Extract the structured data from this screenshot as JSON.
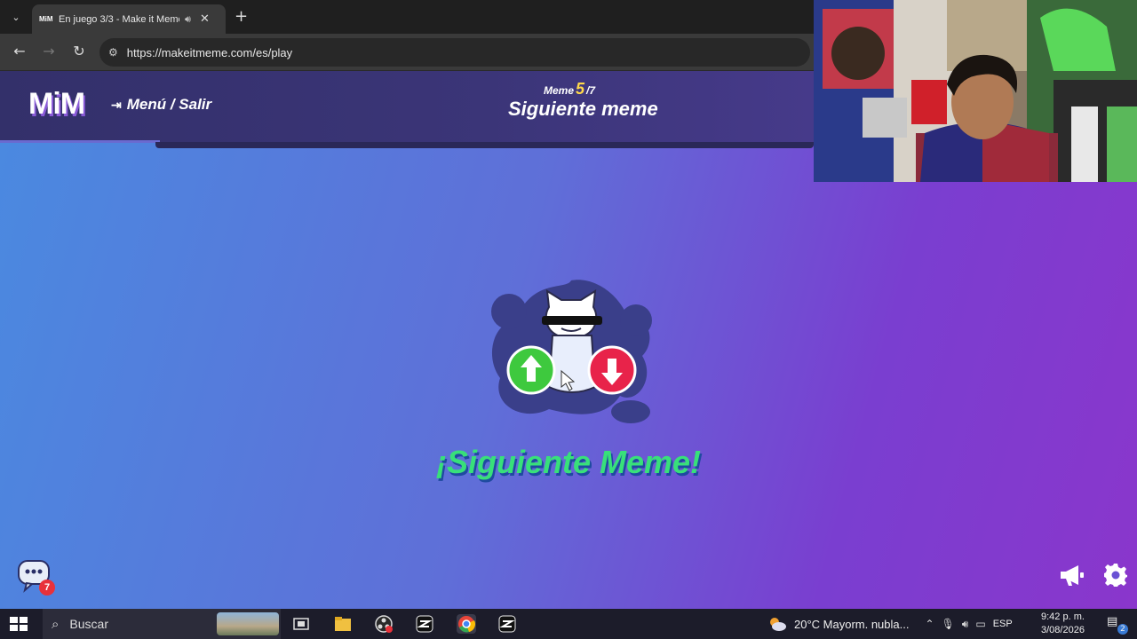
{
  "browser": {
    "tab_title": "En juego 3/3 - Make it Meme",
    "tab_favicon": "MiM",
    "url": "https://makeitmeme.com/es/play",
    "icons": [
      "tab-dropdown-icon",
      "speaker-icon",
      "close-icon",
      "plus-icon",
      "back-arrow-icon",
      "forward-arrow-icon",
      "reload-icon",
      "site-settings-icon"
    ]
  },
  "game": {
    "logo": "MiM",
    "menu_label": "Menú / Salir",
    "counter_prefix": "Meme",
    "counter_current": "5",
    "counter_total": "/7",
    "header_title": "Siguiente meme",
    "banner": "¡Siguiente Meme!",
    "chat_badge": "7",
    "colors": {
      "banner": "#38e07a",
      "counter_highlight": "#ffd84a",
      "upvote": "#3ec93e",
      "downvote": "#e8234a"
    },
    "icons": [
      "exit-icon",
      "cat-mascot-icon",
      "upvote-arrow-icon",
      "downvote-arrow-icon",
      "chat-bubble-icon",
      "megaphone-icon",
      "gear-icon"
    ]
  },
  "taskbar": {
    "search_label": "Buscar",
    "weather": "20°C  Mayorm. nubla...",
    "language": "ESP",
    "time": "9:42 p. m.",
    "date": "3/08/2026",
    "notification_count": "2",
    "icons": [
      "windows-start-icon",
      "search-icon",
      "task-view-icon",
      "file-explorer-icon",
      "obs-icon",
      "capcut-icon",
      "chrome-icon",
      "capcut-icon",
      "weather-icon",
      "chevron-up-icon",
      "microphone-icon",
      "volume-icon",
      "network-icon",
      "notifications-icon"
    ]
  }
}
